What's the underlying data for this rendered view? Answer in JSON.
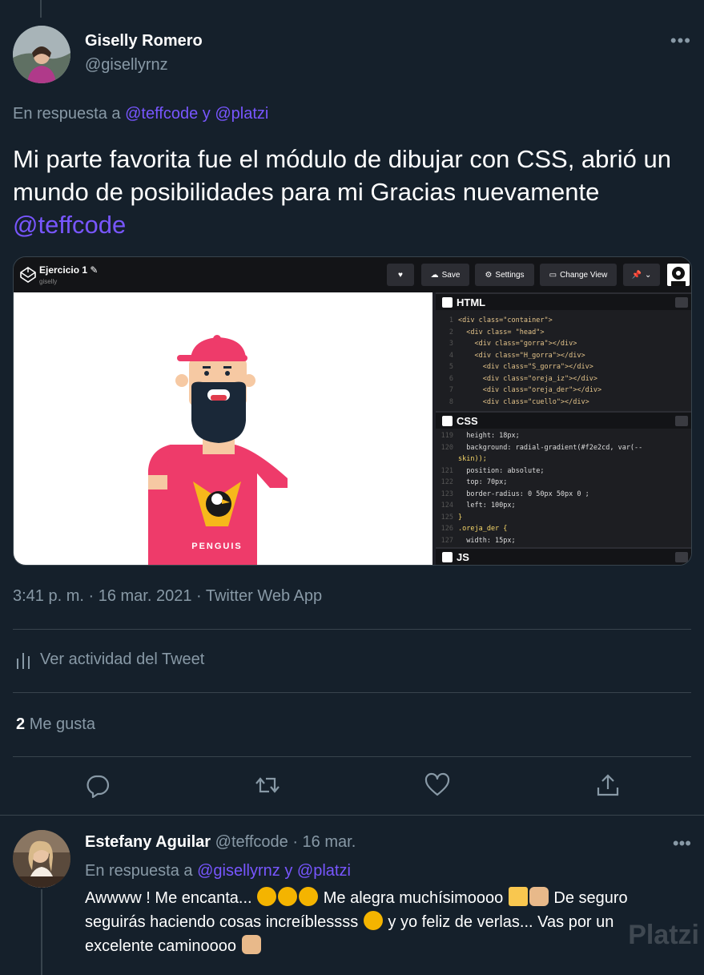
{
  "tweet": {
    "author_name": "Giselly Romero",
    "author_handle": "@gisellyrnz",
    "more_icon": "more-horizontal-icon",
    "reply_prefix": "En respuesta a",
    "reply_mention_1": "@teffcode",
    "reply_join": "y",
    "reply_mention_2": "@platzi",
    "text_part_1": "Mi parte favorita fue el módulo de dibujar con CSS, abrió un mundo de posibilidades para mi  Gracias nuevamente ",
    "text_mention": "@teffcode",
    "timestamp": "3:41 p. m. · 16 mar. 2021 · Twitter Web App",
    "activity_label": "Ver actividad del Tweet",
    "likes_count": "2",
    "likes_label": "Me gusta"
  },
  "codepen": {
    "title": "Ejercicio 1",
    "user": "giselly",
    "buttons": {
      "save": "Save",
      "settings": "Settings",
      "change_view": "Change View"
    },
    "shirt_text": "PENGUIS",
    "html_panel": {
      "label": "HTML",
      "lines": [
        {
          "n": "1",
          "indent": 0,
          "code": "<div class=\"container\">"
        },
        {
          "n": "2",
          "indent": 1,
          "code": "<div class= \"head\">"
        },
        {
          "n": "3",
          "indent": 2,
          "code": "<div class=\"gorra\"></div>"
        },
        {
          "n": "4",
          "indent": 2,
          "code": "<div class=\"H_gorra\"></div>"
        },
        {
          "n": "5",
          "indent": 3,
          "code": "<div class=\"S_gorra\"></div>"
        },
        {
          "n": "6",
          "indent": 3,
          "code": "<div class=\"oreja_iz\"></div>"
        },
        {
          "n": "7",
          "indent": 3,
          "code": "<div class=\"oreja_der\"></div>"
        },
        {
          "n": "8",
          "indent": 3,
          "code": "<div class=\"cuello\"></div>"
        }
      ]
    },
    "css_panel": {
      "label": "CSS",
      "lines": [
        {
          "n": "119",
          "code": "  height: 18px;"
        },
        {
          "n": "120",
          "code": "  background: radial-gradient(#f2e2cd, var(--"
        },
        {
          "n": "",
          "code": "skin));"
        },
        {
          "n": "121",
          "code": "  position: absolute;"
        },
        {
          "n": "122",
          "code": "  top: 70px;"
        },
        {
          "n": "123",
          "code": "  border-radius: 0 50px 50px 0 ;"
        },
        {
          "n": "124",
          "code": "  left: 100px;"
        },
        {
          "n": "125",
          "code": "}"
        },
        {
          "n": "126",
          "code": ".oreja_der {"
        },
        {
          "n": "127",
          "code": "  width: 15px;"
        }
      ]
    },
    "js_panel": {
      "label": "JS"
    }
  },
  "actions": {
    "reply_icon": "reply-icon",
    "retweet_icon": "retweet-icon",
    "like_icon": "heart-icon",
    "share_icon": "share-icon"
  },
  "reply": {
    "author_name": "Estefany Aguilar",
    "author_handle": "@teffcode",
    "date": "· 16 mar.",
    "reply_prefix": "En respuesta a",
    "reply_mention_1": "@gisellyrnz",
    "reply_join": "y",
    "reply_mention_2": "@platzi",
    "text_1": "Awwww ! Me encanta... ",
    "text_2": " Me alegra muchísimoooo ",
    "text_3": " De seguro seguirás haciendo cosas increíblessss ",
    "text_4": " y yo feliz de verlas... Vas por un excelente caminoooo ",
    "emoji_color": "#f4b400"
  },
  "watermark": "Platzi",
  "colors": {
    "background": "#15202b",
    "accent": "#7856ff",
    "secondary_text": "#8899a6",
    "divider": "#38444d",
    "shirt": "#ee3b6a",
    "beard": "#1a2838",
    "skin": "#f6c9a3"
  }
}
